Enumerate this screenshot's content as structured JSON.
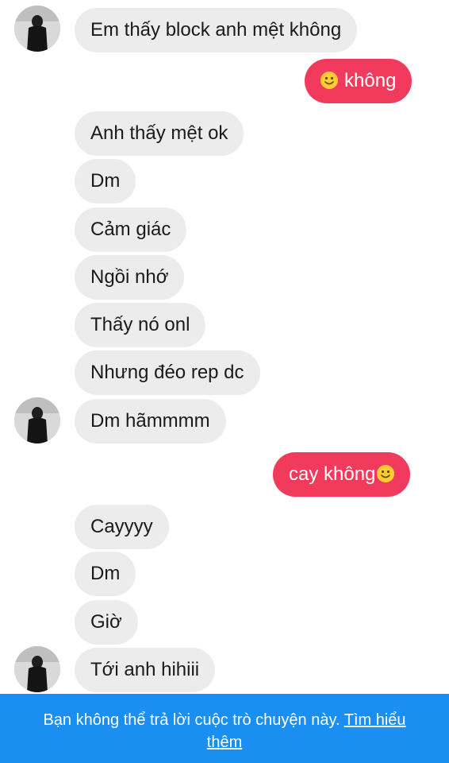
{
  "messages": [
    {
      "text": "Em thấy block anh mệt không",
      "side": "in"
    },
    {
      "text": "không",
      "side": "out",
      "emoji": "smiling-face-emoji"
    },
    {
      "text": "Anh thấy mệt ok",
      "side": "in"
    },
    {
      "text": "Dm",
      "side": "in"
    },
    {
      "text": "Cảm giác",
      "side": "in"
    },
    {
      "text": "Ngồi nhớ",
      "side": "in"
    },
    {
      "text": "Thấy nó onl",
      "side": "in"
    },
    {
      "text": "Nhưng đéo rep dc",
      "side": "in"
    },
    {
      "text": "Dm hãmmmm",
      "side": "in"
    },
    {
      "text": "cay không",
      "side": "out",
      "emoji": "smiling-face-emoji"
    },
    {
      "text": "Cayyyy",
      "side": "in"
    },
    {
      "text": "Dm",
      "side": "in"
    },
    {
      "text": "Giờ",
      "side": "in"
    },
    {
      "text": "Tới anh hihiii",
      "side": "in"
    }
  ],
  "banner": {
    "text": "Bạn không thể trả lời cuộc trò chuyện này.",
    "link_part1": "Tìm hiểu",
    "link_part2": "thêm"
  },
  "colors": {
    "incoming_bubble": "#ececec",
    "outgoing_bubble": "#f23b5c",
    "banner": "#1b8ef2"
  }
}
